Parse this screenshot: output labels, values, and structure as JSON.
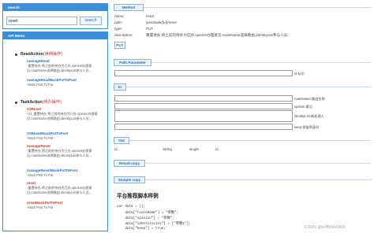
{
  "search": {
    "title": "search",
    "value": "reset",
    "button_label": "search"
  },
  "menu": {
    "title": "API Menu",
    "groups": [
      {
        "name": "ReadAction",
        "subtitle": "(读档操作)",
        "items": [
          {
            "label": "manageRead",
            "desc": "-重置待办,将之前的待办为已办,opinion办理意见,routeName选择路由,identityList参与人员,..."
          },
          {
            "label": "manageReadMockPutToPost",
            "desc": "-Mock Post To Put"
          }
        ]
      },
      {
        "name": "TaskAction",
        "subtitle": "(待办操作)",
        "items": [
          {
            "label": "V2Reset",
            "desc": "-V2_重置待办,将之前的待办为已办,opinion办理意见,routeName选择路由,identityList参与人员,..."
          },
          {
            "label": "V2ResetMockPutToPost",
            "desc": "-Mock Post To Put"
          },
          {
            "label": "manageReset",
            "desc": "-重置待办,将之前的待办为已办,opinion办理意见,routeName选择路由,identityList参与人员,..."
          },
          {
            "label": "manageResetMockPutToPost",
            "desc": "-Mock Post To Put"
          },
          {
            "label": "reset",
            "desc": "-重置待办,将之前的待办为已办,opinion办理意见,routeName选择路由,identityList参与人员,..."
          },
          {
            "label": "resetMockPutToPost",
            "desc": "-Mock Post To Put"
          }
        ]
      }
    ]
  },
  "method": {
    "header": "Method",
    "rows": [
      {
        "key": "name:",
        "value": "reset"
      },
      {
        "key": "path:",
        "value": "jaxrs/task/{id}/reset"
      },
      {
        "key": "type:",
        "value": "PUT"
      },
      {
        "key": "description:",
        "value": "重置待办,将之前的待办为已办,opinion办理意见,routeName选择路由,identityList参与人员."
      }
    ],
    "put_button": "PUT"
  },
  "path_parameter": {
    "header": "Path Parameter",
    "fields": [
      {
        "label": "id:标识"
      }
    ]
  },
  "in": {
    "header": "In",
    "fields": [
      {
        "label": "routeName:路由名称"
      },
      {
        "label": "opinion:意见"
      },
      {
        "label": "identityList:新处理人"
      },
      {
        "label": "keep:保留原身份"
      }
    ]
  },
  "out": {
    "header": "Out",
    "row": [
      "id",
      "String",
      "single",
      "id"
    ]
  },
  "result_copy": {
    "header": "Result copy"
  },
  "sample_copy": {
    "header": "Sample copy"
  },
  "sample": {
    "title": "平台推荐脚本样例",
    "code": [
      "var data = {};",
      "    data[\"routeName\"] = \"参数\";",
      "    data[\"opinion\"] = \"参数\";",
      "    data[\"identityList\"] = [\"参数1\"];",
      "    data[\"keep\"] = true;"
    ]
  },
  "watermark": "CSDN @x086961063"
}
